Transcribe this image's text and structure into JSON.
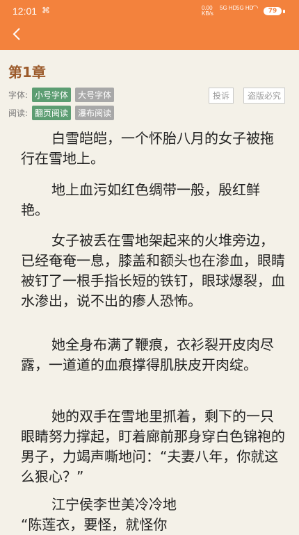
{
  "status": {
    "time": "12:01",
    "net_speed": "0.00\nKB/s",
    "sig1": "5G HD",
    "sig2": "5G HD",
    "battery": "79"
  },
  "chapter": {
    "title": "第1章"
  },
  "controls": {
    "font_label": "字体:",
    "small_font": "小号字体",
    "large_font": "大号字体",
    "read_label": "阅读:",
    "page_mode": "翻页阅读",
    "scroll_mode": "瀑布阅读",
    "complaint": "投诉",
    "piracy": "盗版必究"
  },
  "content": {
    "paras": [
      "白雪皑皑，一个怀胎八月的女子被拖行在雪地上。",
      "地上血污如红色绸带一般，殷红鲜艳。",
      "女子被丢在雪地架起来的火堆旁边，已经奄奄一息，膝盖和额头也在渗血，眼睛被钉了一根手指长短的铁钉，眼球爆裂，血水渗出，说不出的瘆人恐怖。",
      "她全身布满了鞭痕，衣衫裂开皮肉尽露，一道道的血痕撑得肌肤皮开肉绽。",
      "她的双手在雪地里抓着，剩下的一只眼睛努力撑起，盯着廊前那身穿白色锦袍的男子，力竭声嘶地问：“夫妻八年，你就这么狠心？”",
      "江宁侯李世美冷冷地",
      "“陈莲衣，要怪，就怪你"
    ]
  }
}
